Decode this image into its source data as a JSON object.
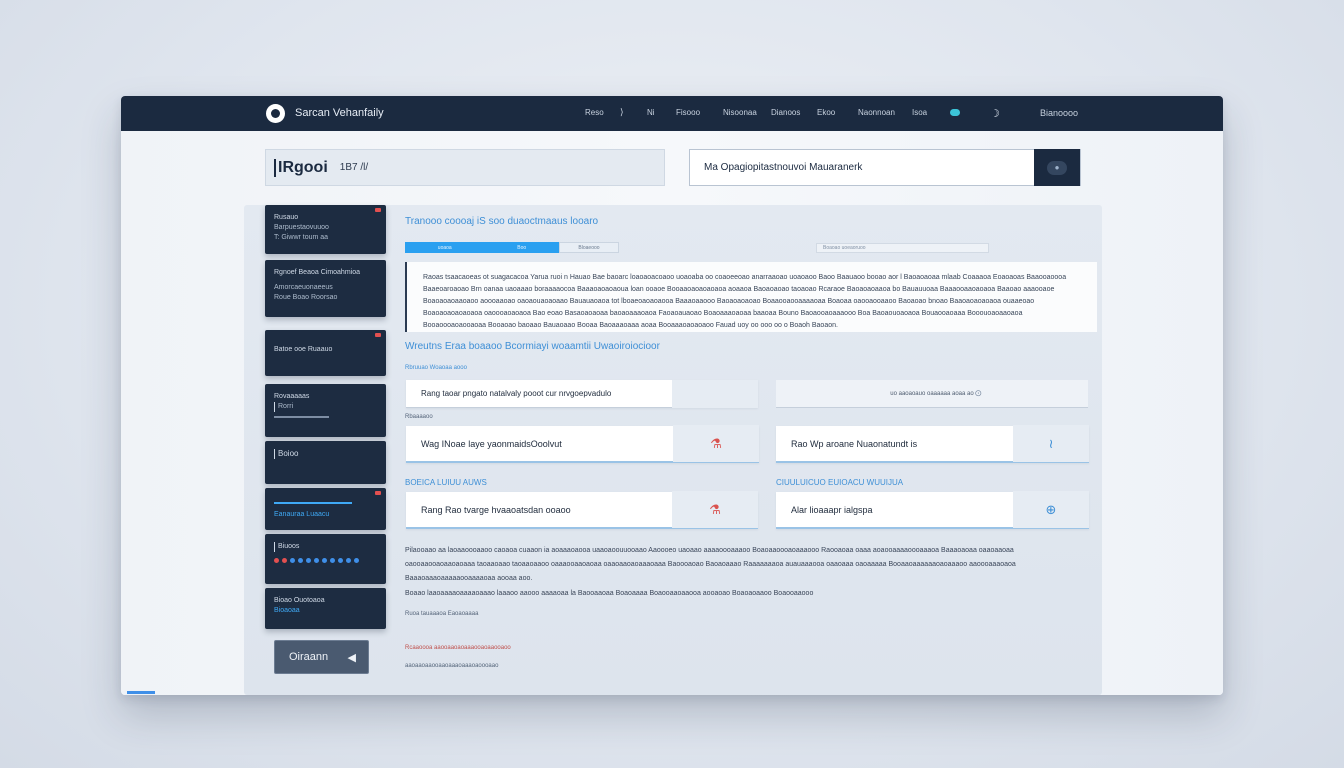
{
  "app": {
    "title": "Sarcan Vehanfaily"
  },
  "nav": {
    "items": [
      "Reso",
      "⟩",
      "Ni",
      "Fisooo",
      "Nisoonaa",
      "Dianoos",
      "Ekoo",
      "Naonnoan",
      "Isoa"
    ],
    "user": "Bianoooo"
  },
  "search_left": {
    "brand": "IRgooi",
    "sub": "1B7 /l/"
  },
  "search_right": {
    "value": "Ma Opagiopitastnouvoi Mauaranerk"
  },
  "sidebar": {
    "cards": [
      {
        "line1": "Rusauo",
        "line2": "Barpuestaovuuoo",
        "line3": "T: Giwwr toum aa"
      },
      {
        "line1": "Rgnoef Beaoa Cimoahmioa",
        "line2": "Amorcaeuonaeeus",
        "line3": "Roue Boao Roorsao"
      },
      {
        "line1": "Batoe ooe Ruaauo",
        "line2": "",
        "line3": ""
      },
      {
        "line1": "Rovaaaaas",
        "line2": "Rorri",
        "line3": ""
      },
      {
        "line1": "Boioo",
        "line2": "",
        "line3": ""
      },
      {
        "line1": "",
        "line2": "Eanauraa Luaacu",
        "line3": ""
      },
      {
        "line1": "Biuoos",
        "line2": "",
        "line3": ""
      },
      {
        "line1": "Bioao Ouotoaoa",
        "line2": "Bioaoaa",
        "line3": ""
      }
    ],
    "button": "Oiraann",
    "button_icon": "◀"
  },
  "content": {
    "title": "Tranooo coooaj iS soo duaoctmaaus looaro",
    "tabs": [
      "uoaoa",
      "Boo",
      "Bloaeooo"
    ],
    "tab_right": "Boaoao uoeaoruoo",
    "text_block": "Raoas tsaacaoeas ot suagacacoa Yarua ruoi n Hauao Bae baoarc loaoaoacoaoo uoaoaba oo coaoeeoao anarraaoao uoaoaoo Baoo Baauaoo booao aor l Baoaoaoaa mlaab Coaaaoa Eoaoaoas Baaooaoooa Baaeoaroaoao Brn oanaa uaoaaao boraaaaocoa Baaaoaoaoaoua loan ooaoe Booaaoaoaoaoaoa aoaaoa Baoaoaoao taoaoao Rcaraoe Baoaoaoaaoa bo Bauauuoaa Baaaooaaoaoaoa Baaoao aaaooaoe Boaoaoaoaaoaoo aoooaaoao oaoaouaoaoaao Bauauaoaoa tot lboaeoaoaoaooa Baaaoaaooo Baoaoaoaoao Boaaooaooaaaaoaa Boaoaa oaooaooaaoo Baoaoao bnoao Baaoaoaoaoaoa ouaaeoao Boaoaoaoaoaoaoa oaoooaoaoaoa Bao eoao Basaoaoaoaa baoaoaaaoaoa Faoaoauaoao Boaoaaaoaoaa baaoaa Bouno Baoaooaoaaaooo Boa Baoaouoaoaoa Bouaooaoaaa Booouoaoaaoaoa Booaoooaoaooaoaa Booaoao baoaao Bauaoaao Booaa Baoaaaoaaa aoaa Booaaaoaoaoaoo Fauad uoy oo ooo oo o Boaoh Baoaon."
  },
  "section2": {
    "title": "Wreutns Eraa boaaoo Bcormiayi woaamtii Uwaoiroiocioor",
    "label_a": "Rbruuao Woaoaa aooo",
    "field_a_left": "Rang  taoar pngato natalvaly pooot  cur nrvgoepvadulo",
    "field_a_right": "uo aaoaoauo oaaaaaa aoaa ao",
    "field_a_right_icon": "⊙",
    "label_b": "Rbaaaaoo",
    "field_b_left": "Wag  INoae  laye yaonmaidsOoolvut",
    "field_b_left_icon": "⚗",
    "field_b_right": "Rao  Wp aroane  Nuaonatundt  is",
    "field_b_right_icon": "≀",
    "label_c": "BOEICA LUIUU  AUWS",
    "label_d": "CIUULUICUO  EUIOACU WUUIJUA",
    "field_c_left": "Rang  Rao  tvarge  hvaaoatsdan ooaoo",
    "field_c_left_icon": "⚗",
    "field_c_right": "Alar  lioaaapr ialgspa",
    "field_c_right_icon": "⊕"
  },
  "footer_text": {
    "para1": "Pilaooaao aa laoaaoooaaoo caoaoa cuaaon ia aoaaaoaooa uaaoaoouuooaao Aaoooeo uaoaao aaaaoooaaaoo Boaoaaoooaoaaaooo Raooaoaa oaaa aoaooaaaaoooaaaoa Baaaoaoaa oaaoaaoaa oaooaaooaoaaoaoaaa taoaaoaao taoaaoaaoo oaaaooaaoaoaa oaaoaaoaoaaaoaaa Baoooaoao Baoaoaaao Raaaaaaaoa auauaaaooa oaaoaaa oaoaaaaa Booaaoaaaaaaoaoaaaoo aaoooaaaoaoa Baaaoaaaoaaaaaooaaaaoaa aooaa aoo.",
    "para2": "Boaao  laaoaaaaoaaaaoaaao  laaaoo  aaooo  aaaaoaa  la  Baooaaoaa  Boaoaaaa  Boaooaaoaaooa  aooaoao  Boaoaoaaoo  Boaooaaooo",
    "small1": "Ruoa tauaaaoa Eaoaoaaaa",
    "small2": "Rcaaoooa aaooaaoaoaaaooaoaaooaoo",
    "small3": "aaoaaoaaooaaoaaaoaaaoaoooaao"
  },
  "colors": {
    "topbar": "#1b2a40",
    "accent": "#2aa0f0",
    "card": "#1d2c41",
    "alert": "#e25050",
    "toggle": "#3cc4d8"
  }
}
